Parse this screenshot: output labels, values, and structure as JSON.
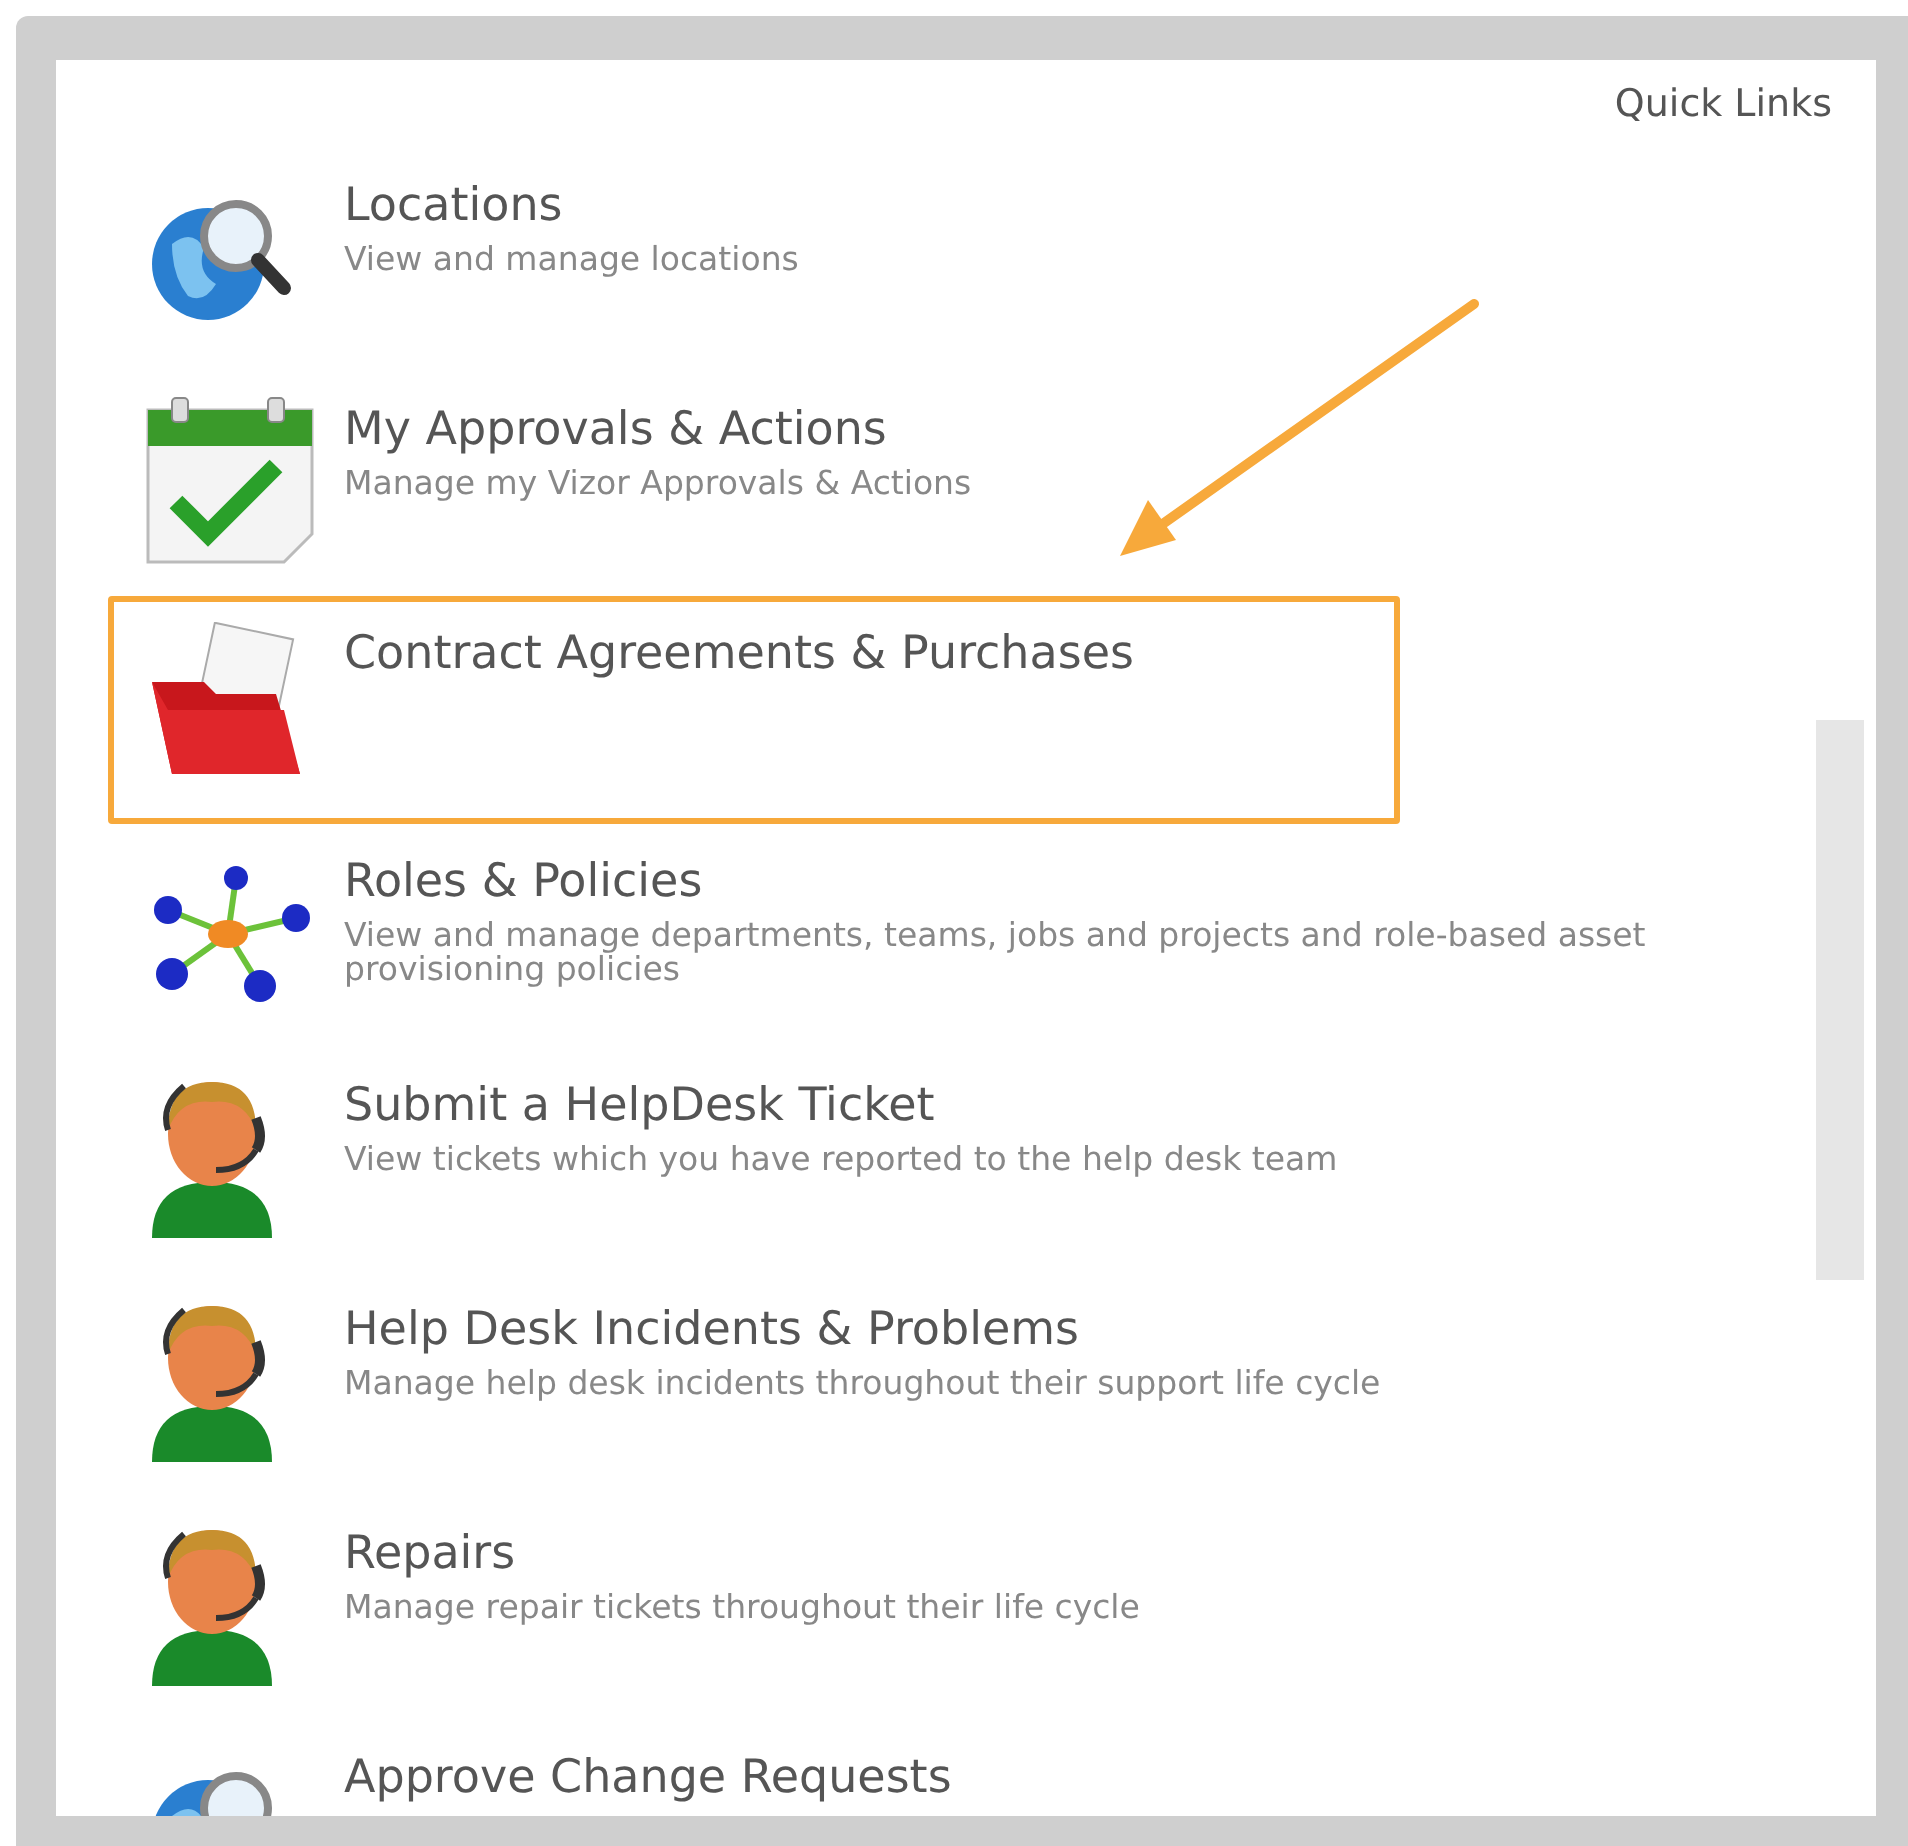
{
  "panel": {
    "title": "Quick Links"
  },
  "links": [
    {
      "kind": "globe",
      "title": "Locations",
      "description": "View and manage locations",
      "highlighted": false
    },
    {
      "kind": "calendar",
      "title": "My Approvals & Actions",
      "description": "Manage my Vizor Approvals & Actions",
      "highlighted": false
    },
    {
      "kind": "folder",
      "title": "Contract Agreements & Purchases",
      "highlighted": true
    },
    {
      "kind": "network",
      "title": "Roles & Policies",
      "description": "View and manage departments, teams, jobs and projects and role-based asset provisioning policies",
      "highlighted": false
    },
    {
      "kind": "agent",
      "title": "Submit a HelpDesk Ticket",
      "description": "View tickets which you have reported to the help desk team",
      "highlighted": false
    },
    {
      "kind": "agent",
      "title": "Help Desk Incidents & Problems",
      "description": "Manage help desk incidents throughout their support life cycle",
      "highlighted": false
    },
    {
      "kind": "agent",
      "title": "Repairs",
      "description": "Manage repair tickets throughout their life cycle",
      "highlighted": false
    },
    {
      "kind": "globe",
      "title": "Approve Change Requests",
      "highlighted": false
    }
  ]
}
